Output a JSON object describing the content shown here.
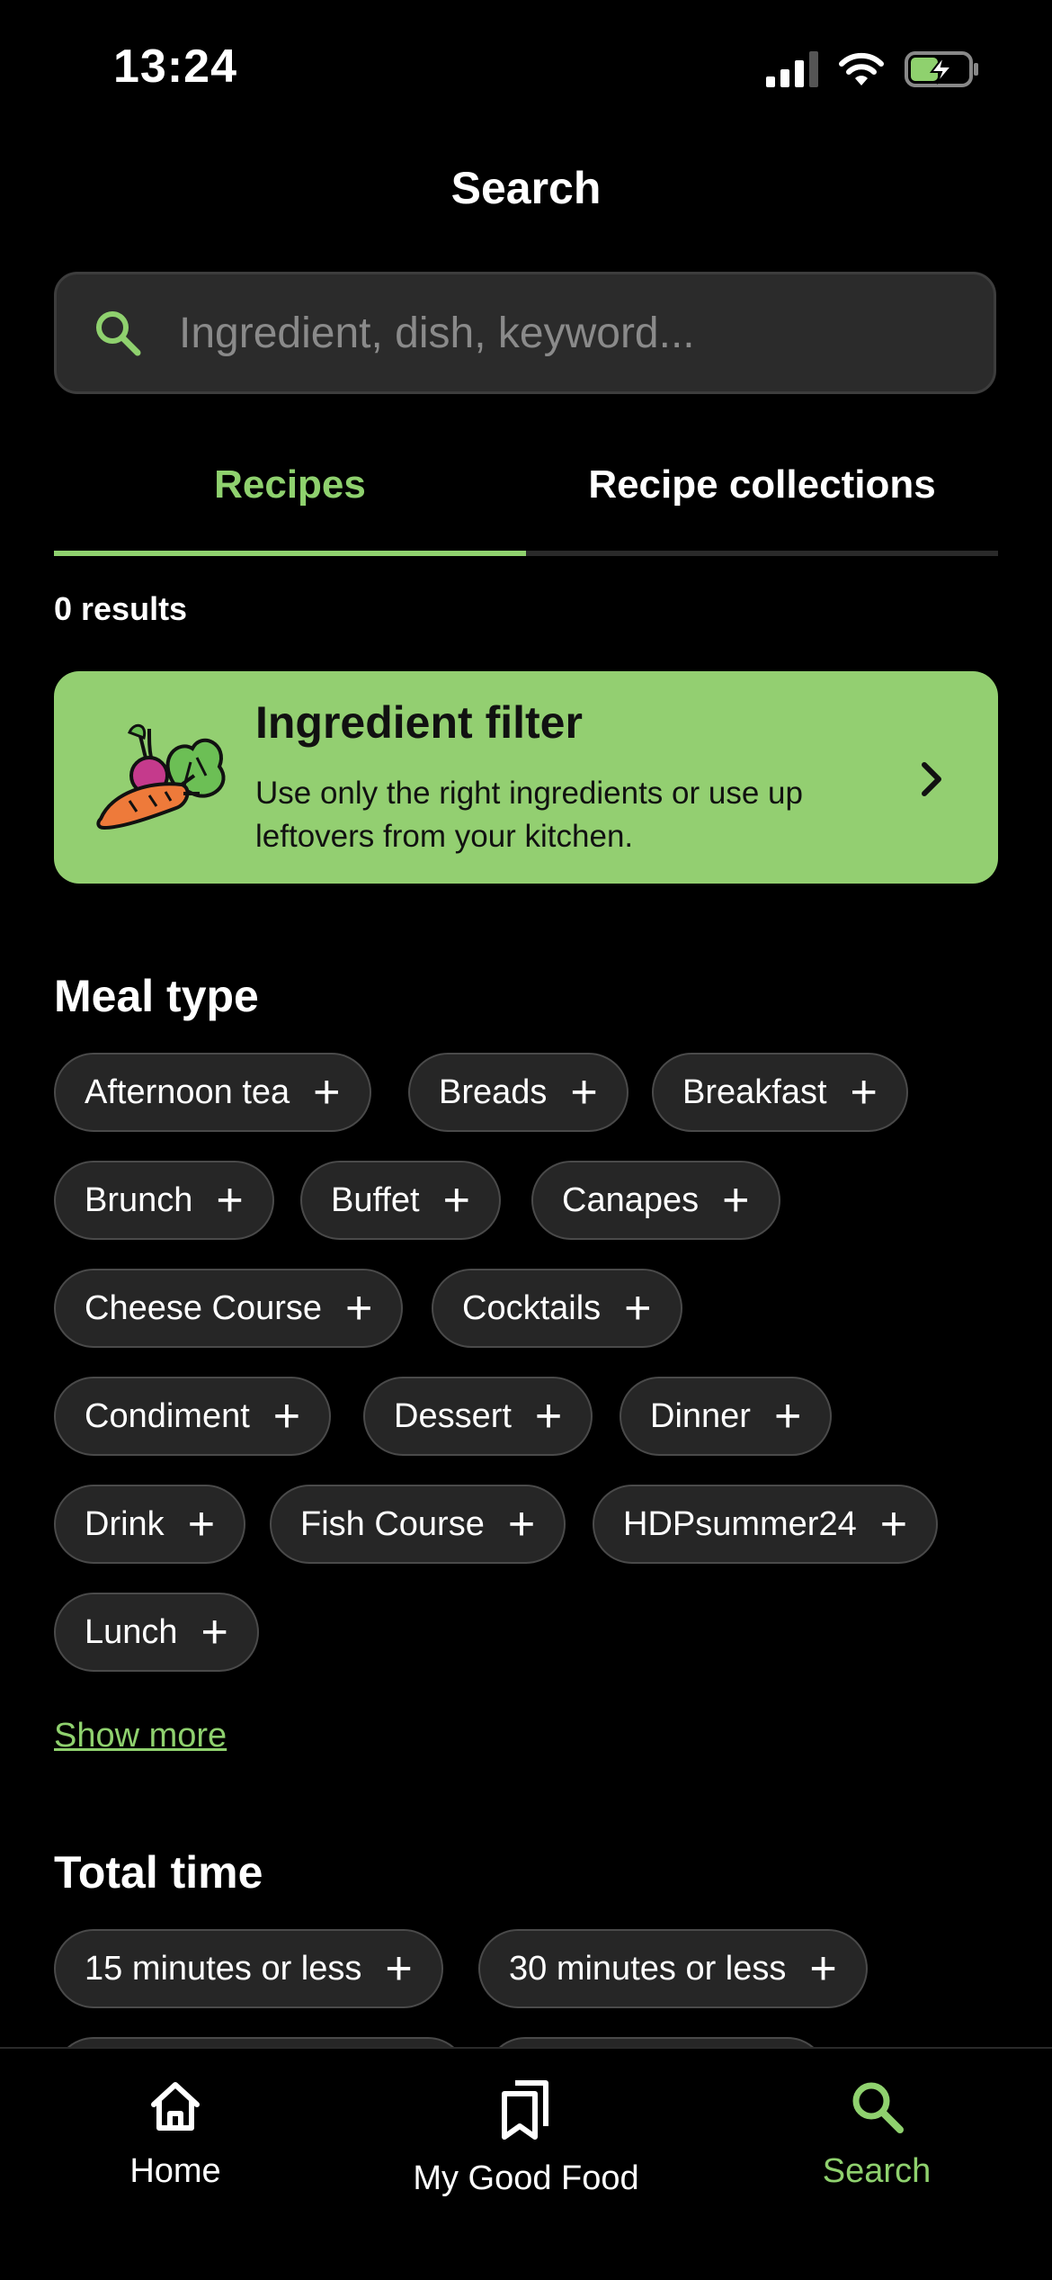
{
  "status_bar": {
    "time": "13:24"
  },
  "header": {
    "title": "Search"
  },
  "search": {
    "placeholder": "Ingredient, dish, keyword..."
  },
  "tabs": [
    {
      "label": "Recipes",
      "active": true
    },
    {
      "label": "Recipe collections",
      "active": false
    }
  ],
  "results": {
    "text": "0 results"
  },
  "ingredient_banner": {
    "title": "Ingredient filter",
    "description": "Use only the right ingredients or use up leftovers from your kitchen."
  },
  "meal_type": {
    "title": "Meal type",
    "chips": [
      "Afternoon tea",
      "Breads",
      "Breakfast",
      "Brunch",
      "Buffet",
      "Canapes",
      "Cheese Course",
      "Cocktails",
      "Condiment",
      "Dessert",
      "Dinner",
      "Drink",
      "Fish Course",
      "HDPsummer24",
      "Lunch"
    ],
    "show_more": "Show more"
  },
  "total_time": {
    "title": "Total time",
    "chips": [
      "15 minutes or less",
      "30 minutes or less"
    ]
  },
  "bottom_nav": [
    {
      "label": "Home",
      "icon": "home-icon",
      "active": false
    },
    {
      "label": "My Good Food",
      "icon": "bookmarks-icon",
      "active": false
    },
    {
      "label": "Search",
      "icon": "search-icon",
      "active": true
    }
  ],
  "colors": {
    "accent": "#8fd16e",
    "banner": "#93cf71",
    "chip_bg": "#262626",
    "background": "#000000"
  }
}
